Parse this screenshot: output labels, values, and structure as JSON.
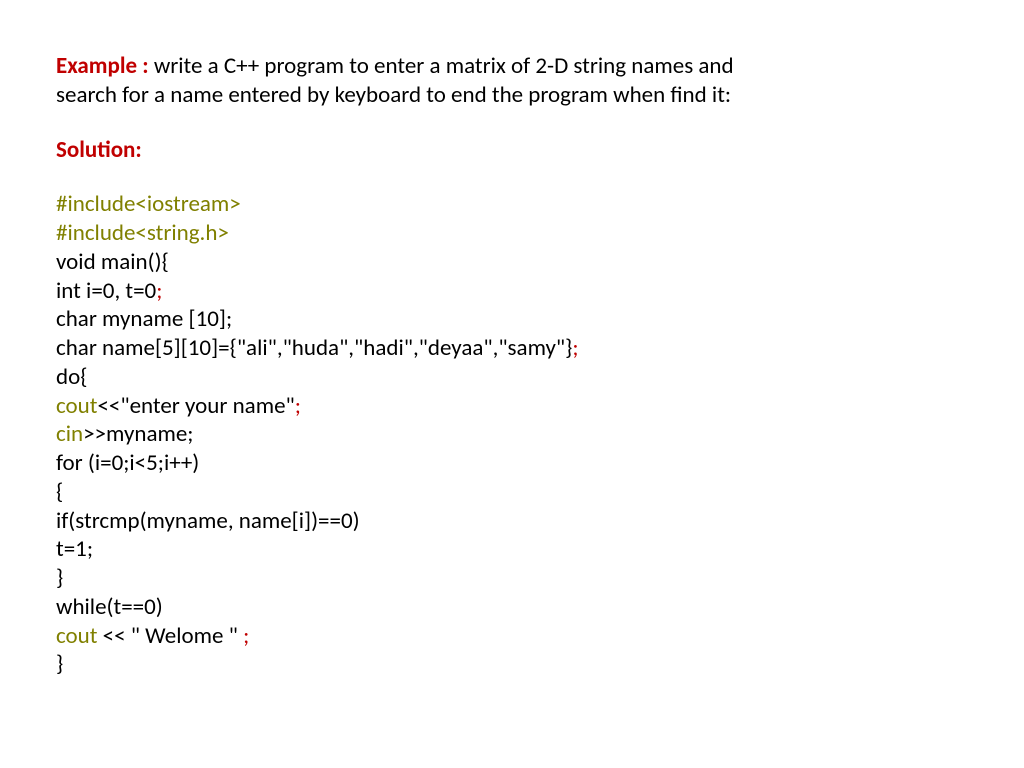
{
  "prompt": {
    "label": "Example : ",
    "text_l1": "write a C++ program to enter a matrix of 2-D string names and",
    "text_l2": "search for a name entered by keyboard to end the program when find it:"
  },
  "solution_label": "Solution:",
  "code": {
    "l1": "#include<iostream>",
    "l2": "#include<string.h>",
    "l3": "void main(){",
    "l4a": "int i=0, t=0",
    "l4b": ";",
    "l5": "char myname [10];",
    "l6a": "char name[5][10]={\"ali\",\"huda\",\"hadi\",\"deyaa\",\"samy\"}",
    "l6b": ";",
    "l7": "do{",
    "l8a": "cout",
    "l8b": "<<\"enter your name\"",
    "l8c": ";",
    "l9a": "cin",
    "l9b": ">>myname;",
    "l10": "for (i=0;i<5;i++)",
    "l11": "{",
    "l12": "if(strcmp(myname, name[i])==0)",
    "l13": "t=1;",
    "l14": "}",
    "l15": "while(t==0)",
    "l16a": "cout ",
    "l16b": "<< \" Welome \" ",
    "l16c": ";",
    "l17": "}"
  }
}
